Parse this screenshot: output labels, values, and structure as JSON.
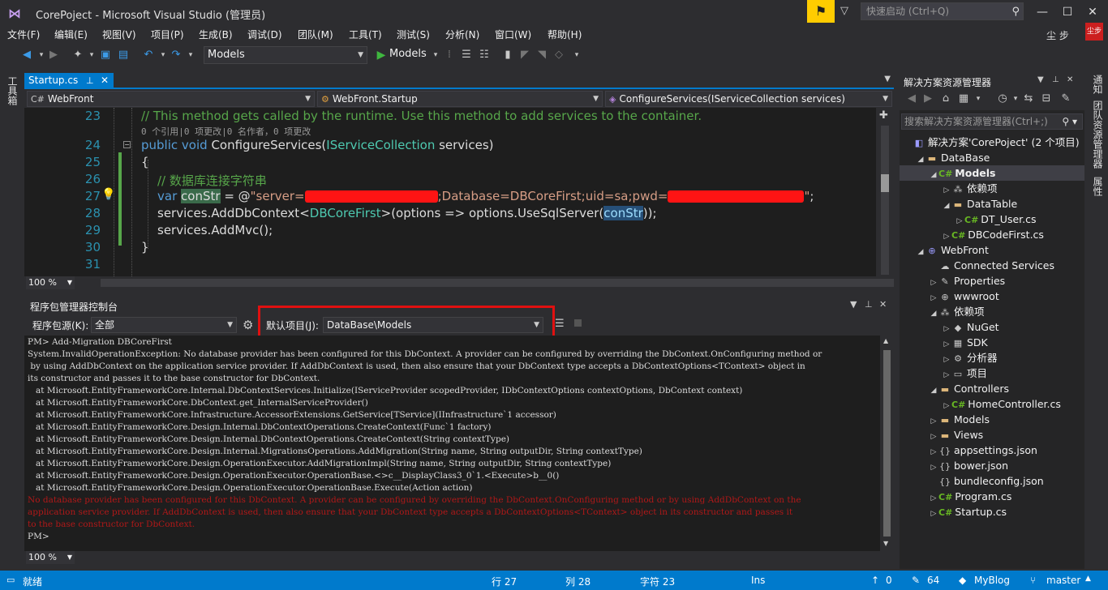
{
  "titlebar": {
    "title": "CorePoject - Microsoft Visual Studio (管理员)",
    "quick_launch_placeholder": "快速启动 (Ctrl+Q)",
    "window_controls": {
      "minimize": "—",
      "maximize": "☐",
      "close": "✕"
    }
  },
  "menu": {
    "items": [
      "文件(F)",
      "编辑(E)",
      "视图(V)",
      "项目(P)",
      "生成(B)",
      "调试(D)",
      "团队(M)",
      "工具(T)",
      "测试(S)",
      "分析(N)",
      "窗口(W)",
      "帮助(H)"
    ],
    "user": "尘 步",
    "user_badge": "尘步"
  },
  "toolbar": {
    "config_combo": "Models",
    "run_label": "Models"
  },
  "left_strip": {
    "label": "工具箱"
  },
  "editor": {
    "tab": {
      "label": "Startup.cs",
      "pin": "⊥",
      "close": "✕"
    },
    "nav": {
      "project": "WebFront",
      "class": "WebFront.Startup",
      "member": "ConfigureServices(IServiceCollection services)"
    },
    "lines": [
      {
        "num": "23",
        "text": "// This method gets called by the runtime. Use this method to add services to the container."
      },
      {
        "lens": "0 个引用|0 项更改|0 名作者，0 项更改"
      },
      {
        "num": "24",
        "kw1": "public",
        "kw2": "void",
        "method": "ConfigureServices(",
        "type": "IServiceCollection",
        "rest": " services)"
      },
      {
        "num": "25",
        "text": "{"
      },
      {
        "num": "26",
        "text": "// 数据库连接字符串"
      },
      {
        "num": "27",
        "kw": "var",
        "var": "conStr",
        "eq": " = @",
        "str1": "\"server=",
        "str2": ";Database=DBCoreFirst;uid=sa;pwd=",
        "str3": "\"",
        "end": ";"
      },
      {
        "num": "28",
        "pre": "services.AddDbContext<",
        "type": "DBCoreFirst",
        "mid": ">(options => options.UseSqlServer(",
        "var": "conStr",
        "end": "));"
      },
      {
        "num": "29",
        "text": "services.AddMvc();"
      },
      {
        "num": "30",
        "text": "}"
      },
      {
        "num": "31",
        "text": ""
      }
    ],
    "zoom": "100 %"
  },
  "package_manager": {
    "title": "程序包管理器控制台",
    "source_label": "程序包源(K):",
    "source_value": "全部",
    "default_project_label": "默认项目(J):",
    "default_project_value": "DataBase\\Models",
    "zoom": "100 %",
    "console_lines": [
      "PM> Add-Migration DBCoreFirst",
      "System.InvalidOperationException: No database provider has been configured for this DbContext. A provider can be configured by overriding the DbContext.OnConfiguring method or",
      " by using AddDbContext on the application service provider. If AddDbContext is used, then also ensure that your DbContext type accepts a DbContextOptions<TContext> object in",
      "its constructor and passes it to the base constructor for DbContext.",
      "   at Microsoft.EntityFrameworkCore.Internal.DbContextServices.Initialize(IServiceProvider scopedProvider, IDbContextOptions contextOptions, DbContext context)",
      "   at Microsoft.EntityFrameworkCore.DbContext.get_InternalServiceProvider()",
      "   at Microsoft.EntityFrameworkCore.Infrastructure.AccessorExtensions.GetService[TService](IInfrastructure`1 accessor)",
      "   at Microsoft.EntityFrameworkCore.Design.Internal.DbContextOperations.CreateContext(Func`1 factory)",
      "   at Microsoft.EntityFrameworkCore.Design.Internal.DbContextOperations.CreateContext(String contextType)",
      "   at Microsoft.EntityFrameworkCore.Design.Internal.MigrationsOperations.AddMigration(String name, String outputDir, String contextType)",
      "   at Microsoft.EntityFrameworkCore.Design.OperationExecutor.AddMigrationImpl(String name, String outputDir, String contextType)",
      "   at Microsoft.EntityFrameworkCore.Design.OperationExecutor.OperationBase.<>c__DisplayClass3_0`1.<Execute>b__0()",
      "   at Microsoft.EntityFrameworkCore.Design.OperationExecutor.OperationBase.Execute(Action action)"
    ],
    "error_lines": [
      "No database provider has been configured for this DbContext. A provider can be configured by overriding the DbContext.OnConfiguring method or by using AddDbContext on the",
      "application service provider. If AddDbContext is used, then also ensure that your DbContext type accepts a DbContextOptions<TContext> object in its constructor and passes it",
      "to the base constructor for DbContext."
    ],
    "prompt": "PM>"
  },
  "solution_explorer": {
    "title": "解决方案资源管理器",
    "search_placeholder": "搜索解决方案资源管理器(Ctrl+;)",
    "items": [
      {
        "label": "解决方案'CorePoject' (2 个项目)",
        "icon": "vs-solution-icon",
        "glyph": "◧",
        "cls": "proj",
        "expander": "",
        "level": 0
      },
      {
        "label": "DataBase",
        "icon": "folder-icon",
        "glyph": "▬",
        "cls": "folder",
        "expander": "◢",
        "level": 1
      },
      {
        "label": "Models",
        "icon": "csharp-project-icon",
        "glyph": "C#",
        "cls": "cs",
        "expander": "◢",
        "level": 2,
        "selected": true
      },
      {
        "label": "依赖项",
        "icon": "dependencies-icon",
        "glyph": "⁂",
        "cls": "plain",
        "expander": "▷",
        "level": 3
      },
      {
        "label": "DataTable",
        "icon": "folder-icon",
        "glyph": "▬",
        "cls": "folder",
        "expander": "◢",
        "level": 3
      },
      {
        "label": "DT_User.cs",
        "icon": "csharp-file-icon",
        "glyph": "C#",
        "cls": "cs",
        "expander": "▷",
        "level": 4
      },
      {
        "label": "DBCodeFirst.cs",
        "icon": "csharp-file-icon",
        "glyph": "C#",
        "cls": "cs",
        "expander": "▷",
        "level": 3
      },
      {
        "label": "WebFront",
        "icon": "web-project-icon",
        "glyph": "⊕",
        "cls": "proj",
        "expander": "◢",
        "level": 1
      },
      {
        "label": "Connected Services",
        "icon": "connected-services-icon",
        "glyph": "☁",
        "cls": "plain",
        "expander": "",
        "level": 2
      },
      {
        "label": "Properties",
        "icon": "wrench-icon",
        "glyph": "✎",
        "cls": "plain",
        "expander": "▷",
        "level": 2
      },
      {
        "label": "wwwroot",
        "icon": "globe-icon",
        "glyph": "⊕",
        "cls": "plain",
        "expander": "▷",
        "level": 2
      },
      {
        "label": "依赖项",
        "icon": "dependencies-icon",
        "glyph": "⁂",
        "cls": "plain",
        "expander": "◢",
        "level": 2
      },
      {
        "label": "NuGet",
        "icon": "nuget-icon",
        "glyph": "◆",
        "cls": "plain",
        "expander": "▷",
        "level": 3
      },
      {
        "label": "SDK",
        "icon": "sdk-icon",
        "glyph": "▦",
        "cls": "plain",
        "expander": "▷",
        "level": 3
      },
      {
        "label": "分析器",
        "icon": "analyzer-icon",
        "glyph": "⚙",
        "cls": "plain",
        "expander": "▷",
        "level": 3
      },
      {
        "label": "项目",
        "icon": "project-ref-icon",
        "glyph": "▭",
        "cls": "plain",
        "expander": "▷",
        "level": 3
      },
      {
        "label": "Controllers",
        "icon": "folder-icon",
        "glyph": "▬",
        "cls": "folder",
        "expander": "◢",
        "level": 2
      },
      {
        "label": "HomeController.cs",
        "icon": "csharp-file-icon",
        "glyph": "C#",
        "cls": "cs",
        "expander": "▷",
        "level": 3
      },
      {
        "label": "Models",
        "icon": "folder-icon",
        "glyph": "▬",
        "cls": "folder",
        "expander": "▷",
        "level": 2
      },
      {
        "label": "Views",
        "icon": "folder-icon",
        "glyph": "▬",
        "cls": "folder",
        "expander": "▷",
        "level": 2
      },
      {
        "label": "appsettings.json",
        "icon": "json-file-icon",
        "glyph": "{}",
        "cls": "plain",
        "expander": "▷",
        "level": 2
      },
      {
        "label": "bower.json",
        "icon": "json-file-icon",
        "glyph": "{}",
        "cls": "plain",
        "expander": "▷",
        "level": 2
      },
      {
        "label": "bundleconfig.json",
        "icon": "json-file-icon",
        "glyph": "{}",
        "cls": "plain",
        "expander": "",
        "level": 2
      },
      {
        "label": "Program.cs",
        "icon": "csharp-file-icon",
        "glyph": "C#",
        "cls": "cs",
        "expander": "▷",
        "level": 2
      },
      {
        "label": "Startup.cs",
        "icon": "csharp-file-icon",
        "glyph": "C#",
        "cls": "cs",
        "expander": "▷",
        "level": 2
      }
    ]
  },
  "right_strip": {
    "labels": [
      "通知",
      "团队资源管理器",
      "属性"
    ]
  },
  "statusbar": {
    "ready": "就绪",
    "line": "行 27",
    "col": "列 28",
    "char": "字符 23",
    "ins": "Ins",
    "up": "0",
    "edits": "64",
    "repo": "MyBlog",
    "branch": "master"
  },
  "colors": {
    "accent": "#007acc",
    "highlight_red": "#e01010",
    "notify": "#ffcc00"
  }
}
